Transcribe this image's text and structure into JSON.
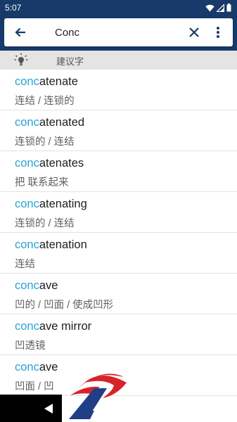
{
  "status_bar": {
    "time": "5:07",
    "icons": [
      "wifi-icon",
      "signal-icon",
      "battery-icon"
    ]
  },
  "search": {
    "query": "Conc",
    "icons": {
      "back": "arrow-back-icon",
      "clear": "close-icon",
      "more": "more-vert-icon"
    }
  },
  "suggestions": {
    "label": "建议字",
    "icon": "lightbulb-icon"
  },
  "results": [
    {
      "highlight": "conc",
      "rest": "atenate",
      "translation": "连结 / 连锁的"
    },
    {
      "highlight": "conc",
      "rest": "atenated",
      "translation": "连锁的 / 连结"
    },
    {
      "highlight": "conc",
      "rest": "atenates",
      "translation": "把 联系起来"
    },
    {
      "highlight": "conc",
      "rest": "atenating",
      "translation": "连锁的 / 连结"
    },
    {
      "highlight": "conc",
      "rest": "atenation",
      "translation": "连结"
    },
    {
      "highlight": "conc",
      "rest": "ave",
      "translation": "凹的 / 凹面 / 使成凹形"
    },
    {
      "highlight": "conc",
      "rest": "ave mirror",
      "translation": "凹透镜"
    },
    {
      "highlight": "conc",
      "rest": "ave",
      "translation": "凹面 / 凹"
    }
  ],
  "colors": {
    "header": "#173a6b",
    "highlight": "#2aa3d6",
    "suggest_bg": "#e4e4e4"
  },
  "nav": {
    "back_icon": "triangle-back-icon"
  },
  "watermark": {
    "icon": "brand-logo-icon"
  }
}
